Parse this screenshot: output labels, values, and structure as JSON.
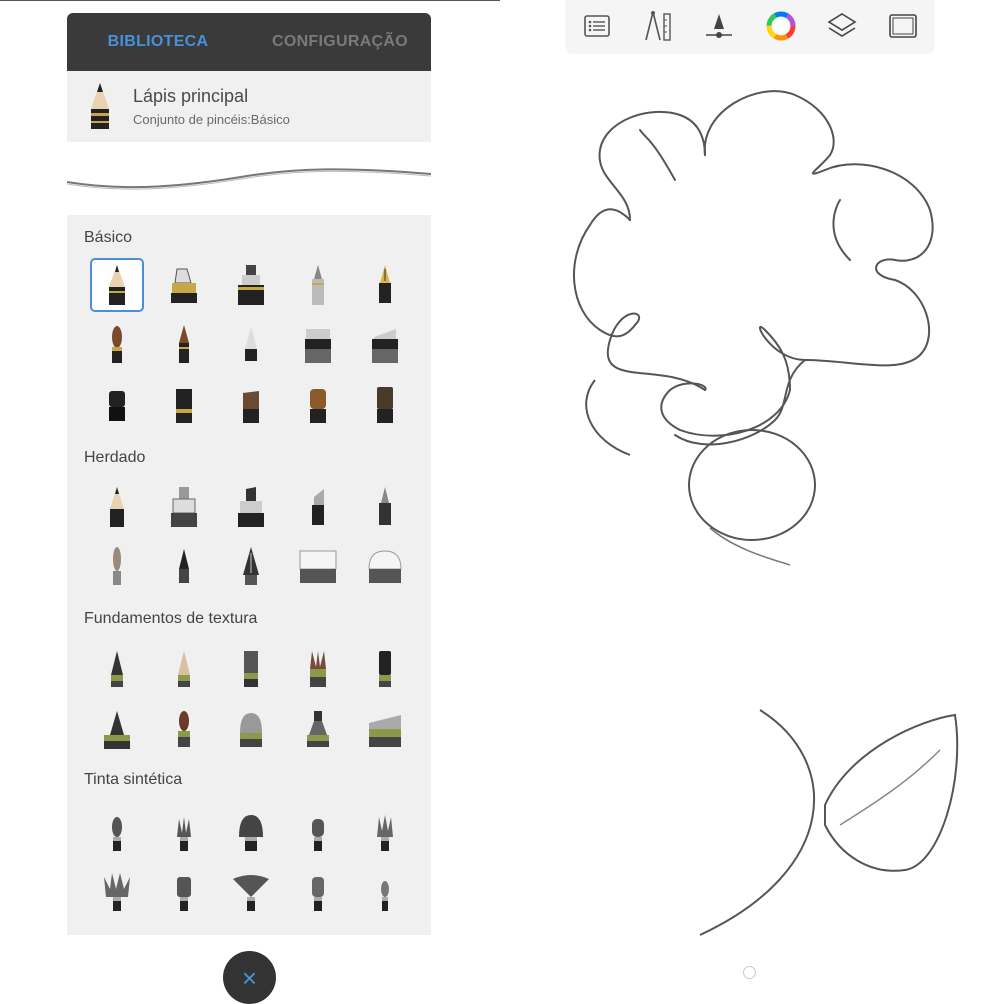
{
  "tabs": {
    "library": "BIBLIOTECA",
    "settings": "CONFIGURAÇÃO"
  },
  "current_brush": {
    "name": "Lápis principal",
    "set": "Conjunto de pincéis:Básico"
  },
  "sections": {
    "basic": {
      "title": "Básico"
    },
    "legacy": {
      "title": "Herdado"
    },
    "texture": {
      "title": "Fundamentos de textura"
    },
    "synthetic": {
      "title": "Tinta sintética"
    }
  },
  "colors": {
    "accent": "#4a90d9",
    "tab_bar": "#3a3a3a",
    "panel": "#f0f0f0",
    "close_button": "#333333"
  },
  "toolbar": {
    "icons": [
      "list-icon",
      "ruler-compass-icon",
      "symmetry-icon",
      "color-wheel-icon",
      "layers-icon",
      "fullscreen-icon"
    ]
  },
  "close_button": {
    "icon": "close-icon",
    "label": "×"
  }
}
